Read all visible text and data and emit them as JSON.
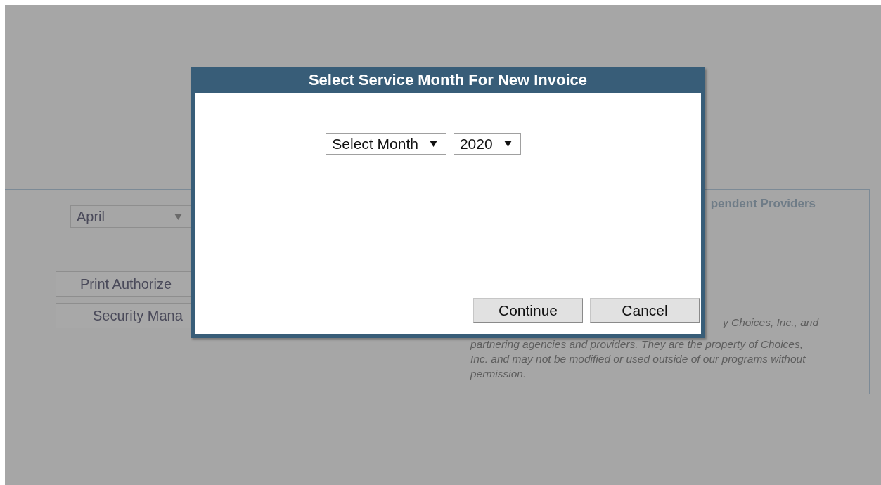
{
  "background": {
    "left_panel": {
      "month_select": {
        "value": "April"
      },
      "buttons": [
        "Print Authorize",
        "Security Mana"
      ]
    },
    "right_panel": {
      "title": "pendent Providers",
      "notice_fragment": "y Choices, Inc., and",
      "notice": "partnering agencies and providers. They are the property of Choices, Inc. and may not be modified or used outside of our programs without permission."
    }
  },
  "dialog": {
    "title": "Select Service Month For New Invoice",
    "selects": [
      {
        "value": "Select Month"
      },
      {
        "value": "2020"
      }
    ],
    "buttons": [
      "Continue",
      "Cancel"
    ]
  }
}
